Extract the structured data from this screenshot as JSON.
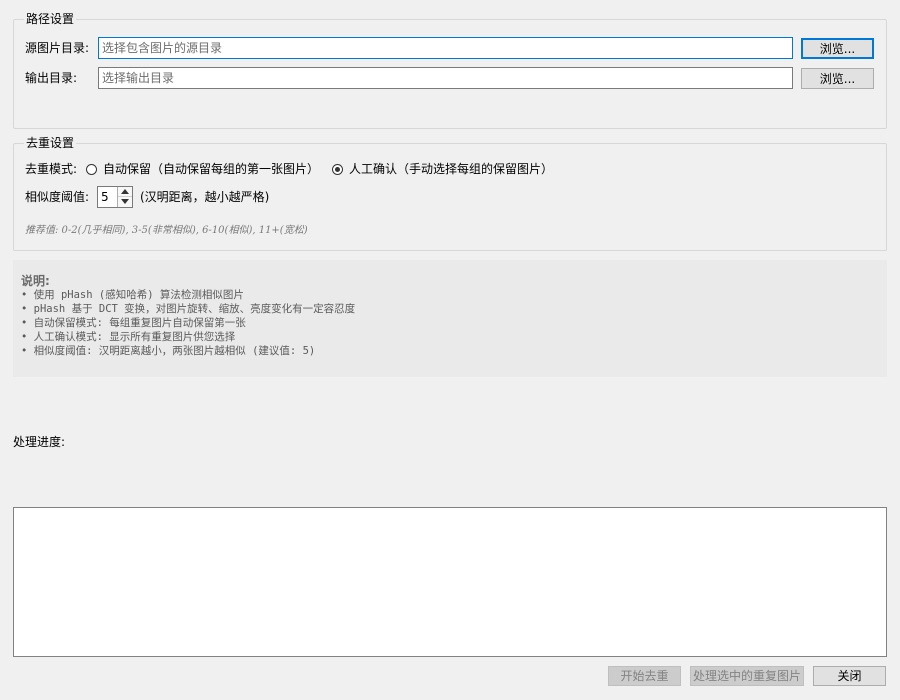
{
  "path_settings": {
    "title": "路径设置",
    "source_label": "源图片目录:",
    "source_placeholder": "选择包含图片的源目录",
    "output_label": "输出目录:",
    "output_placeholder": "选择输出目录",
    "browse_label": "浏览..."
  },
  "dedup_settings": {
    "title": "去重设置",
    "mode_label": "去重模式:",
    "modes": [
      {
        "label": "自动保留（自动保留每组的第一张图片）",
        "checked": false
      },
      {
        "label": "人工确认（手动选择每组的保留图片）",
        "checked": true
      }
    ],
    "threshold_label": "相似度阈值:",
    "threshold_value": "5",
    "threshold_note": "(汉明距离，越小越严格)",
    "hint": "推荐值: 0-2(几乎相同), 3-5(非常相似), 6-10(相似), 11+(宽松)"
  },
  "info": {
    "title": "说明:",
    "lines": [
      "• 使用 pHash (感知哈希) 算法检测相似图片",
      "• pHash 基于 DCT 变换，对图片旋转、缩放、亮度变化有一定容忍度",
      "• 自动保留模式: 每组重复图片自动保留第一张",
      "• 人工确认模式: 显示所有重复图片供您选择",
      "• 相似度阈值: 汉明距离越小，两张图片越相似 (建议值: 5)"
    ]
  },
  "progress": {
    "label": "处理进度:"
  },
  "actions": {
    "start_label": "开始去重",
    "process_label": "处理选中的重复图片",
    "close_label": "关闭"
  }
}
